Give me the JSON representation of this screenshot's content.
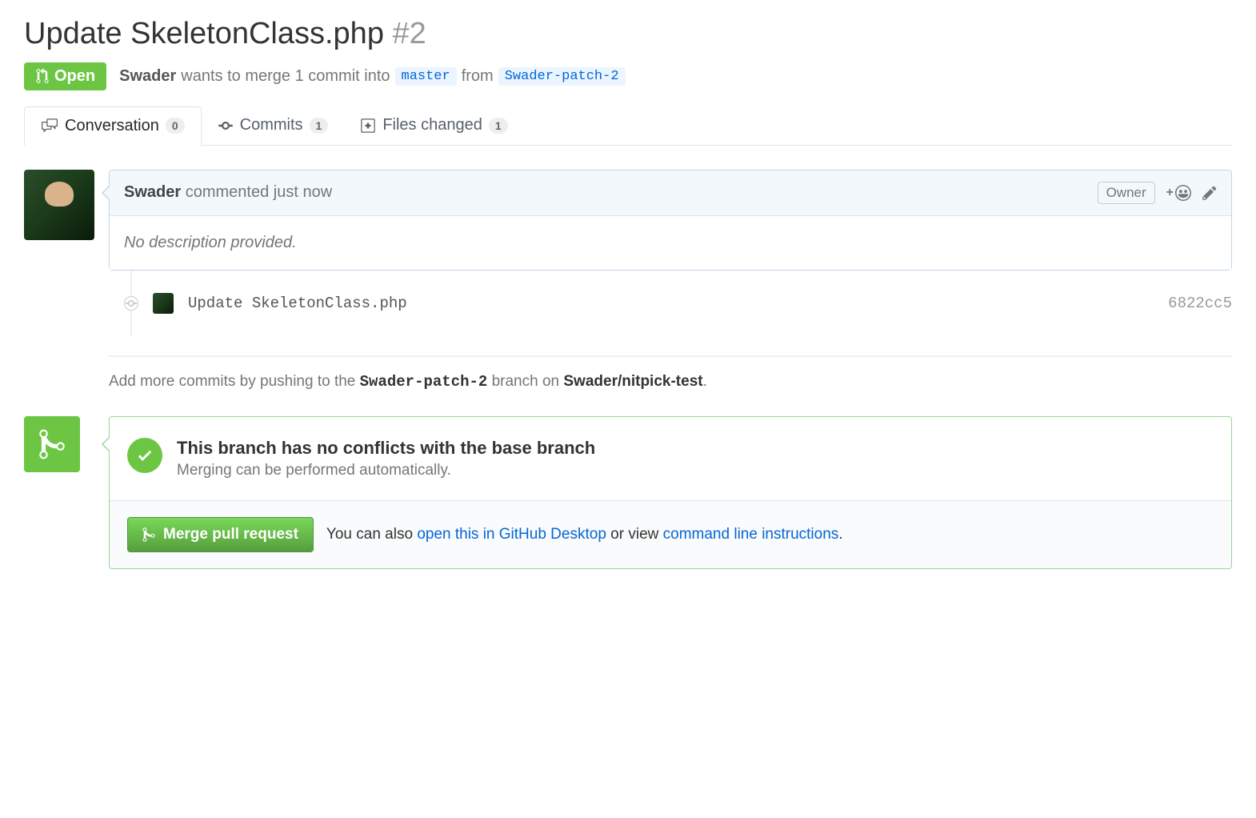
{
  "title": "Update SkeletonClass.php",
  "issue_number": "#2",
  "state": "Open",
  "meta": {
    "author": "Swader",
    "text1": "wants to merge 1 commit into",
    "base_branch": "master",
    "text2": "from",
    "head_branch": "Swader-patch-2"
  },
  "tabs": {
    "conversation": {
      "label": "Conversation",
      "count": "0"
    },
    "commits": {
      "label": "Commits",
      "count": "1"
    },
    "files": {
      "label": "Files changed",
      "count": "1"
    }
  },
  "comment": {
    "author": "Swader",
    "action": "commented",
    "time": "just now",
    "owner_badge": "Owner",
    "body": "No description provided."
  },
  "commit": {
    "message": "Update SkeletonClass.php",
    "sha": "6822cc5"
  },
  "hint": {
    "prefix": "Add more commits by pushing to the",
    "branch": "Swader-patch-2",
    "mid": "branch on",
    "repo": "Swader/nitpick-test",
    "suffix": "."
  },
  "merge": {
    "heading": "This branch has no conflicts with the base branch",
    "sub": "Merging can be performed automatically.",
    "button": "Merge pull request",
    "alt_prefix": "You can also",
    "alt_link1": "open this in GitHub Desktop",
    "alt_mid": "or view",
    "alt_link2": "command line instructions",
    "alt_suffix": "."
  }
}
